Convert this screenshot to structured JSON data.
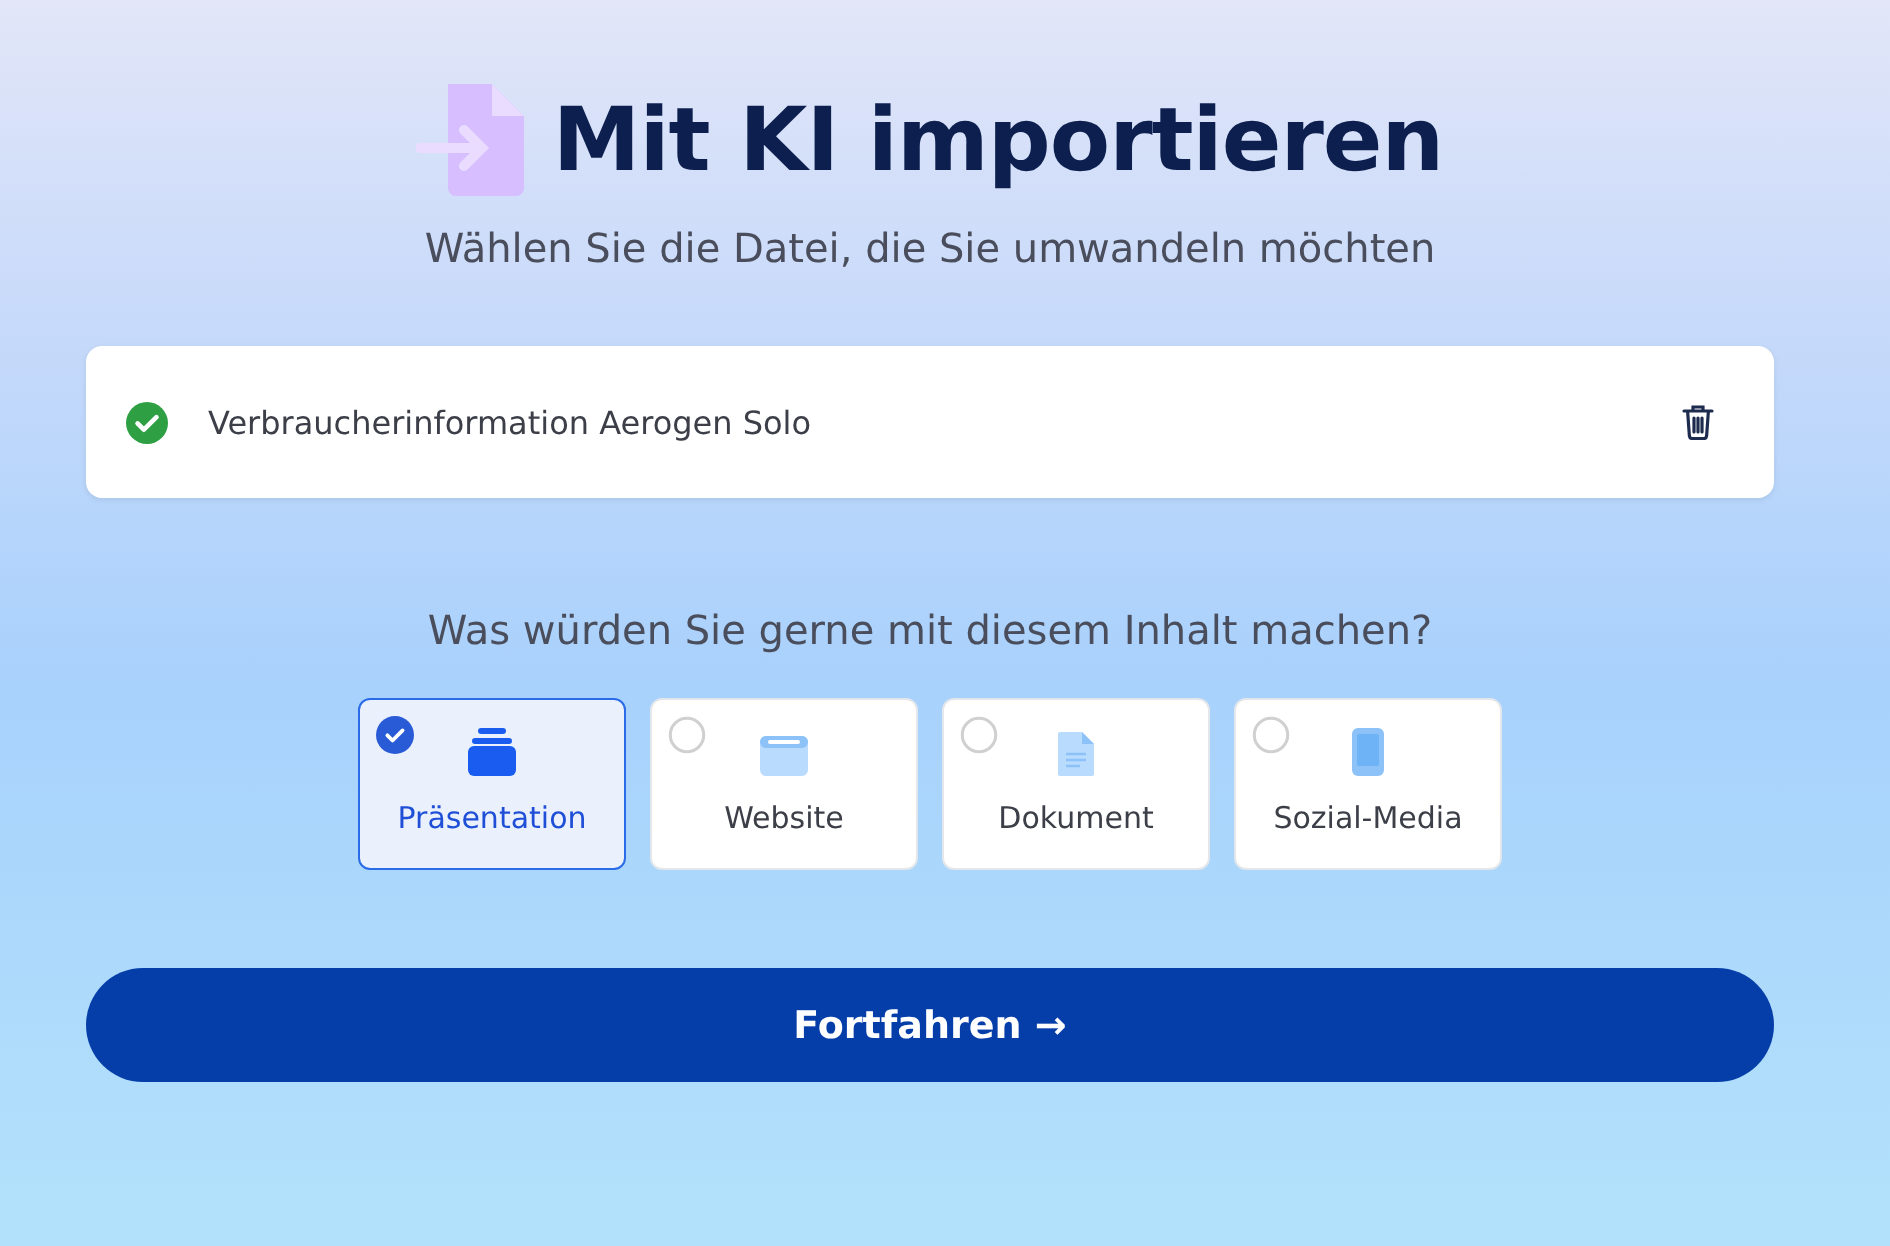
{
  "title": "Mit KI importieren",
  "subtitle": "Wählen Sie die Datei, die Sie umwandeln möchten",
  "file": {
    "name": "Verbraucherinformation Aerogen Solo",
    "uploaded": true
  },
  "question": "Was würden Sie gerne mit diesem Inhalt machen?",
  "options": [
    {
      "kind": "presentation",
      "label": "Präsentation",
      "selected": true
    },
    {
      "kind": "website",
      "label": "Website",
      "selected": false
    },
    {
      "kind": "document",
      "label": "Dokument",
      "selected": false
    },
    {
      "kind": "social",
      "label": "Sozial-Media",
      "selected": false
    }
  ],
  "continue_button": {
    "label": "Fortfahren",
    "arrow": "→"
  }
}
